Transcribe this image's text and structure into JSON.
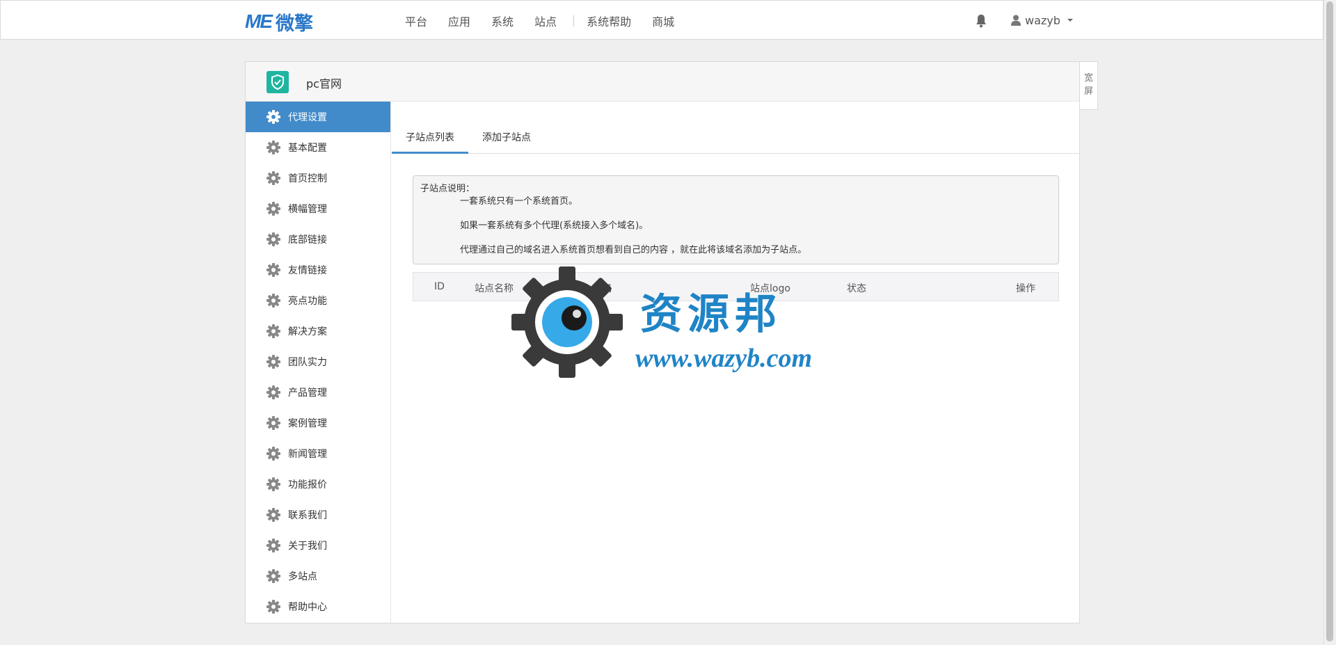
{
  "navbar": {
    "logo_mark": "ME",
    "logo_text": "微擎",
    "links": [
      "平台",
      "应用",
      "系统",
      "站点",
      "系统帮助",
      "商城"
    ],
    "username": "wazyb"
  },
  "panel": {
    "site_name": "pc官网",
    "widescreen_label": "宽屏"
  },
  "sidebar": {
    "items": [
      {
        "label": "代理设置",
        "active": true
      },
      {
        "label": "基本配置"
      },
      {
        "label": "首页控制"
      },
      {
        "label": "横幅管理"
      },
      {
        "label": "底部链接"
      },
      {
        "label": "友情链接"
      },
      {
        "label": "亮点功能"
      },
      {
        "label": "解决方案"
      },
      {
        "label": "团队实力"
      },
      {
        "label": "产品管理"
      },
      {
        "label": "案例管理"
      },
      {
        "label": "新闻管理"
      },
      {
        "label": "功能报价"
      },
      {
        "label": "联系我们"
      },
      {
        "label": "关于我们"
      },
      {
        "label": "多站点"
      },
      {
        "label": "帮助中心"
      }
    ]
  },
  "tabs": [
    "子站点列表",
    "添加子站点"
  ],
  "notice": {
    "title": "子站点说明：",
    "line1": "一套系统只有一个系统首页。",
    "line2": "如果一套系统有多个代理(系统接入多个域名)。",
    "line3": "代理通过自己的域名进入系统首页想看到自己的内容 ，就在此将该域名添加为子站点。"
  },
  "table": {
    "columns": [
      "ID",
      "站点名称",
      "域名",
      "站点logo",
      "状态",
      "操作"
    ]
  },
  "watermark": {
    "title": "资源邦",
    "url": "www.wazyb.com"
  },
  "colors": {
    "accent": "#428bca",
    "site_icon": "#1fb5a0",
    "watermark": "#1f84c6"
  }
}
